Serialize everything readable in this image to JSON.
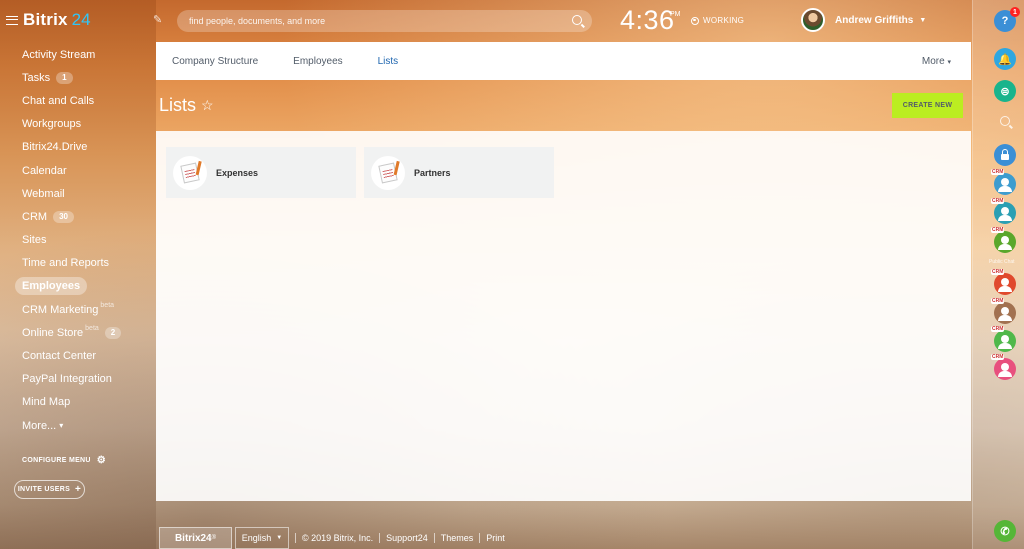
{
  "brand": {
    "name": "Bitrix",
    "number": "24"
  },
  "sidebar": {
    "items": [
      {
        "label": "Activity Stream"
      },
      {
        "label": "Tasks",
        "counter": "1"
      },
      {
        "label": "Chat and Calls"
      },
      {
        "label": "Workgroups"
      },
      {
        "label": "Bitrix24.Drive"
      },
      {
        "label": "Calendar"
      },
      {
        "label": "Webmail"
      },
      {
        "label": "CRM",
        "counter": "30"
      },
      {
        "label": "Sites"
      },
      {
        "label": "Time and Reports"
      },
      {
        "label": "Employees",
        "active": true
      },
      {
        "label": "CRM Marketing",
        "beta": "beta"
      },
      {
        "label": "Online Store",
        "beta": "beta",
        "counter": "2"
      },
      {
        "label": "Contact Center"
      },
      {
        "label": "PayPal Integration"
      },
      {
        "label": "Mind Map"
      },
      {
        "label": "More...",
        "chevron": "▾"
      }
    ],
    "configure_label": "CONFIGURE MENU",
    "invite_label": "INVITE USERS"
  },
  "header": {
    "search_placeholder": "find people, documents, and more",
    "time": "4:36",
    "ampm": "PM",
    "status": "WORKING",
    "user_name": "Andrew Griffiths"
  },
  "tabs": {
    "items": [
      {
        "label": "Company Structure"
      },
      {
        "label": "Employees"
      },
      {
        "label": "Lists",
        "active": true
      }
    ],
    "more_label": "More"
  },
  "page": {
    "title": "Lists",
    "create_button": "CREATE NEW",
    "cards": [
      {
        "label": "Expenses"
      },
      {
        "label": "Partners"
      }
    ]
  },
  "footer": {
    "logo": "Bitrix24",
    "language": "English",
    "copyright": "© 2019 Bitrix, Inc.",
    "links": [
      "Support24",
      "Themes",
      "Print"
    ]
  },
  "rightbar": {
    "help_label": "?",
    "help_badge": "1",
    "crm_tag": "CRM",
    "caption": "Public Chat"
  },
  "colors": {
    "accent_blue": "#2067b0",
    "create_green": "#bbed21",
    "brand_cyan": "#2fc6f6"
  }
}
